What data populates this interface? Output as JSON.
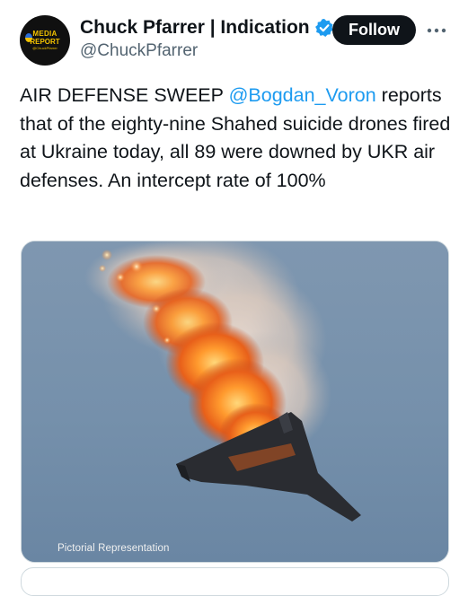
{
  "author": {
    "display_name": "Chuck Pfarrer | Indication",
    "handle": "@ChuckPfarrer",
    "verified": true,
    "avatar": {
      "line1": "MEDIA",
      "line2": "REPORT",
      "line3": "@ChuckPfarrer"
    }
  },
  "header": {
    "follow_label": "Follow",
    "more_icon": "more-horizontal-icon"
  },
  "tweet": {
    "text_before": "AIR DEFENSE SWEEP ",
    "mention": "@Bogdan_Voron",
    "text_after": " reports that of the eighty-nine Shahed suicide drones fired at Ukraine today, all 89 were downed by UKR air defenses.  An intercept rate of 100%"
  },
  "media": {
    "caption": "Pictorial Representation"
  },
  "colors": {
    "accent": "#1d9bf0",
    "text": "#0f1419",
    "secondary_text": "#536471",
    "follow_button_bg": "#0f1419",
    "sky": "#7590ab"
  }
}
